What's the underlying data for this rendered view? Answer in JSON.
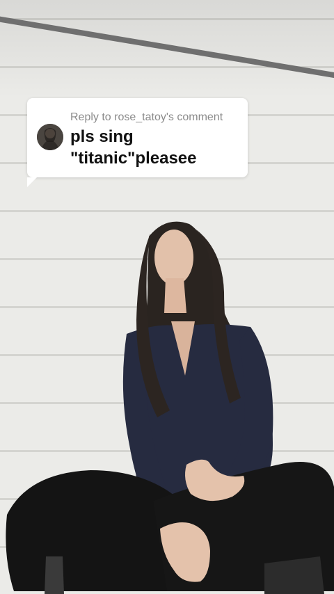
{
  "reply": {
    "header": "Reply to rose_tatoy's comment",
    "line1": "pls sing",
    "line2": "\"titanic\"pleasee"
  },
  "icons": {
    "avatar": "user-avatar"
  },
  "colors": {
    "card_bg": "#ffffff",
    "header_text": "#8a8a8a",
    "comment_text": "#111111"
  }
}
